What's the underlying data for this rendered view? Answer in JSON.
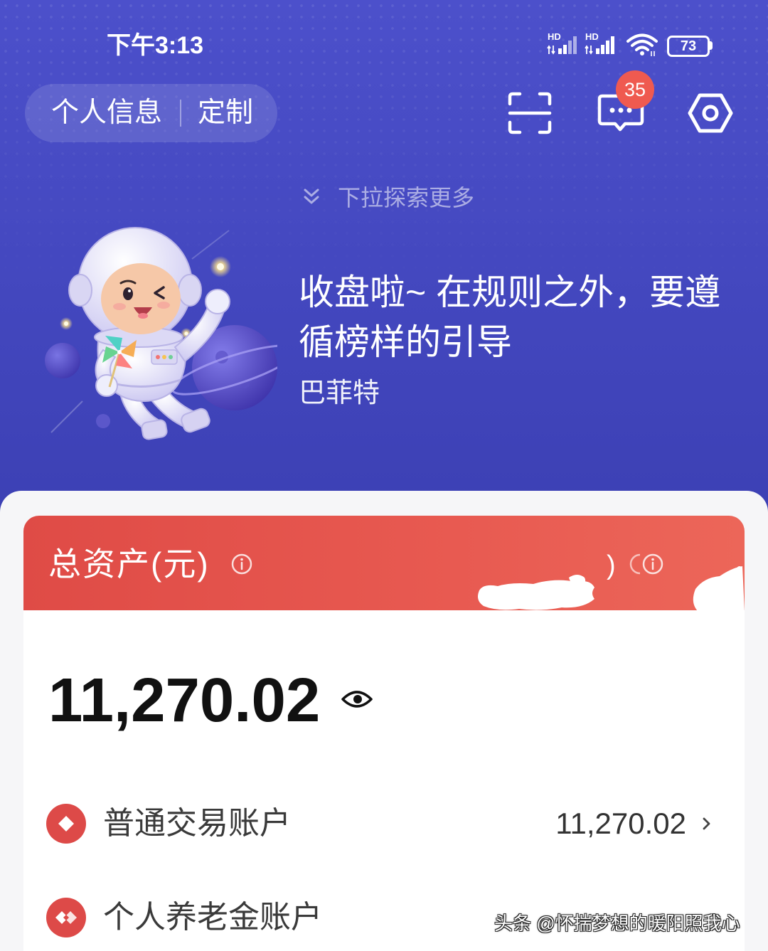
{
  "status_bar": {
    "time": "下午3:13",
    "signal_1_label": "HD",
    "signal_2_label": "HD",
    "battery": "73",
    "icons": [
      "signal-icon",
      "signal-icon",
      "wifi-icon",
      "battery-icon"
    ]
  },
  "top_bar": {
    "profile_link": "个人信息",
    "customize_link": "定制",
    "actions": [
      {
        "icon": "scan-icon"
      },
      {
        "icon": "message-icon",
        "badge": "35"
      },
      {
        "icon": "settings-icon"
      }
    ]
  },
  "pull_hint": {
    "icon": "double-chevron-down-icon",
    "text": "下拉探索更多"
  },
  "banner": {
    "illustration": "astronaut-illustration",
    "quote": "收盘啦~ 在规则之外，要遵循榜样的引导",
    "author": "巴菲特"
  },
  "assets_card": {
    "title": "总资产(元)",
    "title_icon": "info-icon",
    "secondary_fragment": ")",
    "secondary_icon": "info-icon",
    "total": "11,270.02",
    "visibility_icon": "eye-icon",
    "accounts": [
      {
        "name": "普通交易账户",
        "value": "11,270.02",
        "icon": "diamond-icon"
      },
      {
        "name": "个人养老金账户",
        "icon": "pension-icon"
      }
    ]
  },
  "watermark": "头条 @怀揣梦想的暖阳照我心",
  "colors": {
    "hero_background": "#4549c1",
    "accent_red": "#e2524b",
    "badge_red": "#ef5a50",
    "panel_background": "#f6f6f8",
    "total_text": "#111111"
  }
}
